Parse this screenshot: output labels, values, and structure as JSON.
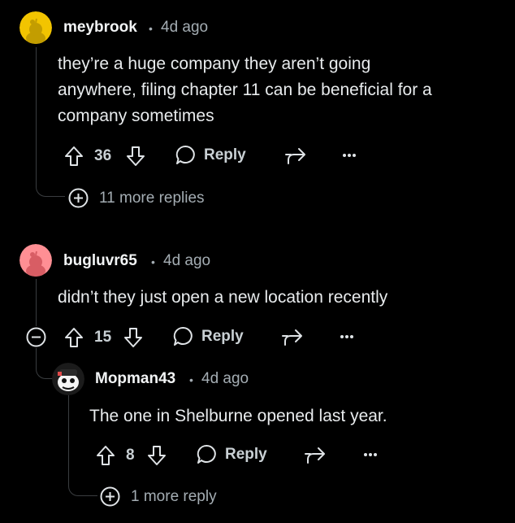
{
  "comments": [
    {
      "username": "meybrook",
      "time": "4d ago",
      "body": [
        "they’re a huge company they aren’t going",
        "anywhere, filing chapter 11 can be beneficial for a",
        "company sometimes"
      ],
      "votes": "36",
      "reply_label": "Reply",
      "more_replies": "11 more replies",
      "avatar_color": "#f2c400"
    },
    {
      "username": "bugluvr65",
      "time": "4d ago",
      "body": [
        "didn’t they just open a new location recently"
      ],
      "votes": "15",
      "reply_label": "Reply",
      "avatar_color": "#ff8f94"
    },
    {
      "username": "Mopman43",
      "time": "4d ago",
      "body": [
        "The one in Shelburne opened last year."
      ],
      "votes": "8",
      "reply_label": "Reply",
      "more_replies": "1 more reply",
      "avatar_color": "#f4f4f4"
    }
  ],
  "separator": "•",
  "icons": {
    "upvote": "arrow-up-icon",
    "downvote": "arrow-down-icon",
    "reply": "comment-bubble-icon",
    "share": "share-icon",
    "more": "ellipsis-icon",
    "expand": "plus-circle-icon",
    "collapse": "minus-circle-icon"
  },
  "colors": {
    "background": "#000000",
    "text": "#e8ebed",
    "muted": "#a4adb3",
    "thread": "#3a3d40"
  }
}
